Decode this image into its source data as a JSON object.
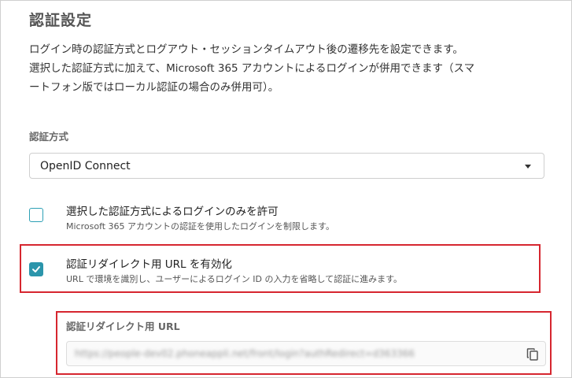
{
  "page": {
    "title": "認証設定",
    "description_lines": [
      "ログイン時の認証方式とログアウト・セッションタイムアウト後の遷移先を設定できます。",
      "選択した認証方式に加えて、Microsoft 365 アカウントによるログインが併用できます（スマ",
      "ートフォン版ではローカル認証の場合のみ併用可）。"
    ]
  },
  "auth_method": {
    "label": "認証方式",
    "selected": "OpenID Connect"
  },
  "options": [
    {
      "title": "選択した認証方式によるログインのみを許可",
      "subtitle": "Microsoft 365 アカウントの認証を使用したログインを制限します。",
      "checked": false
    },
    {
      "title": "認証リダイレクト用 URL を有効化",
      "subtitle": "URL で環境を識別し、ユーザーによるログイン ID の入力を省略して認証に進みます。",
      "checked": true
    }
  ],
  "redirect_url": {
    "label": "認証リダイレクト用 URL",
    "value": "https://people-dev02.phoneappli.net/front/login?authRedirect=d363366"
  },
  "colors": {
    "accent": "#2b95ab",
    "highlight": "#d6262f"
  },
  "icons": {
    "copy": "copy-icon",
    "dropdown": "chevron-down-icon",
    "check": "check-icon"
  }
}
